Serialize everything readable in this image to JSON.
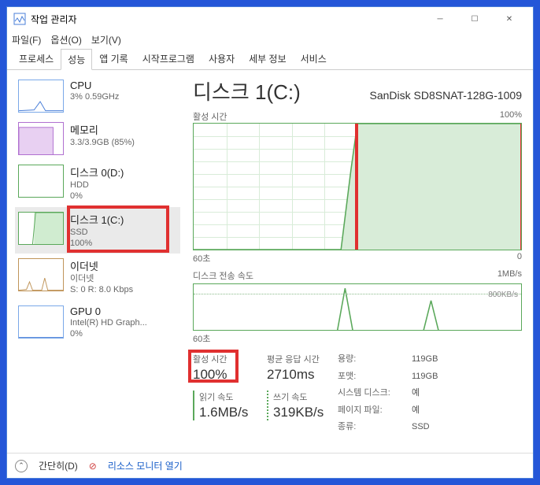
{
  "window": {
    "title": "작업 관리자"
  },
  "menu": {
    "file": "파일(F)",
    "options": "옵션(O)",
    "view": "보기(V)"
  },
  "tabs": [
    "프로세스",
    "성능",
    "앱 기록",
    "시작프로그램",
    "사용자",
    "세부 정보",
    "서비스"
  ],
  "sidebar": {
    "cpu": {
      "name": "CPU",
      "sub": "3% 0.59GHz"
    },
    "memory": {
      "name": "메모리",
      "sub": "3.3/3.9GB (85%)"
    },
    "disk0": {
      "name": "디스크 0(D:)",
      "sub1": "HDD",
      "sub2": "0%"
    },
    "disk1": {
      "name": "디스크 1(C:)",
      "sub1": "SSD",
      "sub2": "100%"
    },
    "eth": {
      "name": "이더넷",
      "sub1": "이더넷",
      "sub2": "S: 0  R: 8.0 Kbps"
    },
    "gpu": {
      "name": "GPU 0",
      "sub1": "Intel(R) HD Graph...",
      "sub2": "0%"
    }
  },
  "header": {
    "title": "디스크 1(C:)",
    "model": "SanDisk SD8SNAT-128G-1009"
  },
  "chart1": {
    "label": "활성 시간",
    "ymax": "100%",
    "xleft": "60초",
    "xright": "0"
  },
  "chart2": {
    "label": "디스크 전송 속도",
    "ymax": "1MB/s",
    "dotted": "800KB/s",
    "xleft": "60초"
  },
  "stats": {
    "active": {
      "label": "활성 시간",
      "value": "100%"
    },
    "resp": {
      "label": "평균 응답 시간",
      "value": "2710ms"
    },
    "read": {
      "label": "읽기 속도",
      "value": "1.6MB/s"
    },
    "write": {
      "label": "쓰기 속도",
      "value": "319KB/s"
    }
  },
  "details": {
    "capacity_k": "용량:",
    "capacity_v": "119GB",
    "format_k": "포맷:",
    "format_v": "119GB",
    "sysdisk_k": "시스템 디스크:",
    "sysdisk_v": "예",
    "pagefile_k": "페이지 파일:",
    "pagefile_v": "예",
    "type_k": "종류:",
    "type_v": "SSD"
  },
  "footer": {
    "simple": "간단히(D)",
    "resmon": "리소스 모니터 열기"
  },
  "chart_data": {
    "type": "line",
    "title": "활성 시간",
    "xlabel": "60초",
    "ylabel": "",
    "ylim": [
      0,
      100
    ],
    "x": [
      0,
      5,
      10,
      15,
      20,
      25,
      28,
      30,
      32,
      34,
      36,
      38,
      40,
      42,
      44,
      46,
      48,
      50,
      52,
      54,
      56,
      58,
      60
    ],
    "values": [
      0,
      0,
      0,
      0,
      0,
      0,
      0,
      60,
      100,
      100,
      100,
      100,
      100,
      100,
      100,
      100,
      100,
      100,
      100,
      100,
      100,
      100,
      100
    ]
  }
}
